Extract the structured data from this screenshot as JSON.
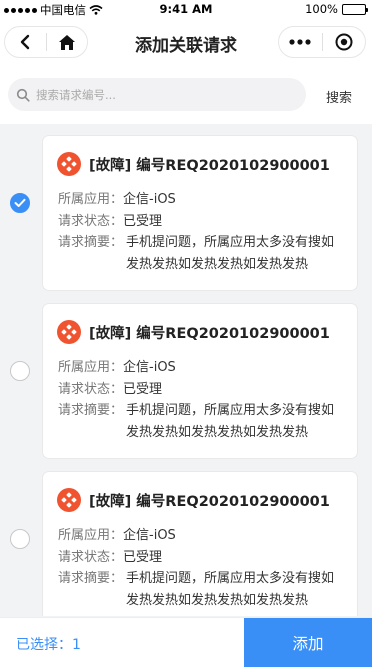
{
  "status_bar": {
    "carrier": "中国电信",
    "time": "9:41 AM",
    "battery": "100%"
  },
  "nav": {
    "title": "添加关联请求"
  },
  "search": {
    "placeholder": "搜索请求编号...",
    "value": "",
    "button_label": "搜索"
  },
  "requests": [
    {
      "selected": true,
      "title": "[故障] 编号REQ2020102900001",
      "app_label": "所属应用：",
      "app_value": "企信-iOS",
      "status_label": "请求状态：",
      "status_value": "已受理",
      "summary_label": "请求摘要：",
      "summary_value": "手机提问题，所属应用太多没有搜如发热发热如发热发热如发热发热"
    },
    {
      "selected": false,
      "title": "[故障] 编号REQ2020102900001",
      "app_label": "所属应用：",
      "app_value": "企信-iOS",
      "status_label": "请求状态：",
      "status_value": "已受理",
      "summary_label": "请求摘要：",
      "summary_value": "手机提问题，所属应用太多没有搜如发热发热如发热发热如发热发热"
    },
    {
      "selected": false,
      "title": "[故障] 编号REQ2020102900001",
      "app_label": "所属应用：",
      "app_value": "企信-iOS",
      "status_label": "请求状态：",
      "status_value": "已受理",
      "summary_label": "请求摘要：",
      "summary_value": "手机提问题，所属应用太多没有搜如发热发热如发热发热如发热发热"
    }
  ],
  "footer": {
    "selected_text": "已选择：1",
    "add_label": "添加"
  },
  "colors": {
    "accent": "#3a8ff7",
    "badge": "#f0532f"
  }
}
